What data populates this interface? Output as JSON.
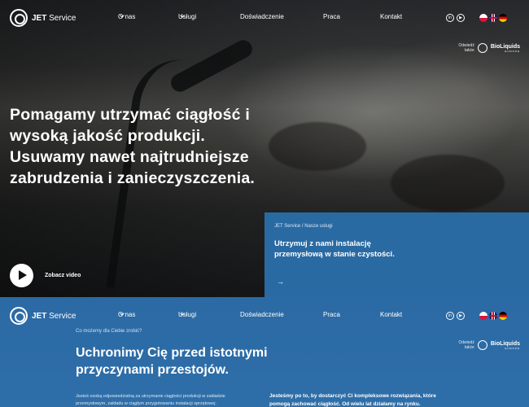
{
  "brand": {
    "name_bold": "JET",
    "name_rest": " Service"
  },
  "nav": {
    "items": [
      {
        "label": "O nas",
        "has_dropdown": true
      },
      {
        "label": "Usługi",
        "has_dropdown": true
      },
      {
        "label": "Doświadczenie",
        "has_dropdown": false
      },
      {
        "label": "Praca",
        "has_dropdown": false
      },
      {
        "label": "Kontakt",
        "has_dropdown": false
      }
    ],
    "social": [
      {
        "icon": "linkedin-icon",
        "glyph": "in"
      },
      {
        "icon": "youtube-icon",
        "glyph": "▶"
      }
    ],
    "languages": [
      "pl",
      "en",
      "de"
    ]
  },
  "visit": {
    "line1": "Odwiedź",
    "line2": "także",
    "brand": "BioLiquids",
    "brand_sub": "EUROPE"
  },
  "hero": {
    "headline": "Pomagamy utrzymać ciągłość i wysoką jakość produkcji. Usuwamy nawet najtrudniejsze zabrudzenia i zanieczyszczenia.",
    "video_label": "Zobacz video"
  },
  "card": {
    "breadcrumb": "JET Service / Nasze usługi",
    "title": "Utrzymuj z nami instalację przemysłową w stanie czystości.",
    "arrow": "→"
  },
  "section2": {
    "eyebrow": "Co możemy dla Ciebie zrobić?",
    "heading": "Uchronimy Cię przed istotnymi przyczynami przestojów.",
    "para_left": "Jesteś osobą odpowiedzialną za utrzymanie ciągłości produkcji w zakładzie przemysłowym, zakładu w ciągłym przygotowaniu instalacji sprzętowej.",
    "para_right": "Jesteśmy po to, by dostarczyć Ci kompleksowe rozwiązania, które pomogą zachować ciągłość. Od wielu lat działamy na rynku."
  },
  "colors": {
    "accent_blue": "#2a6aa3",
    "hero_dark": "#2b2d30"
  }
}
